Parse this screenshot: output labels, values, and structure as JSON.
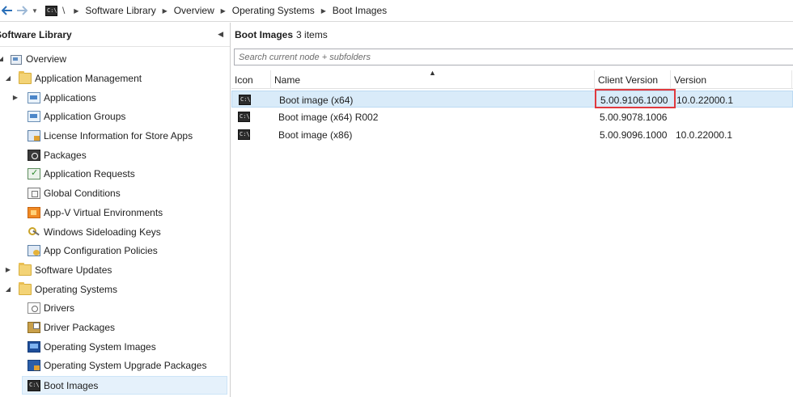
{
  "breadcrumb": {
    "root": "\\",
    "items": [
      "Software Library",
      "Overview",
      "Operating Systems",
      "Boot Images"
    ]
  },
  "left_pane": {
    "title": "Software Library",
    "tree": [
      {
        "label": "Overview",
        "icon": "overview-icon",
        "level": 0,
        "expander": "expanded"
      },
      {
        "label": "Application Management",
        "icon": "folder-icon",
        "level": 1,
        "expander": "expanded"
      },
      {
        "label": "Applications",
        "icon": "application-icon",
        "level": 2,
        "expander": "collapsed"
      },
      {
        "label": "Application Groups",
        "icon": "application-group-icon",
        "level": 2
      },
      {
        "label": "License Information for Store Apps",
        "icon": "license-icon",
        "level": 2
      },
      {
        "label": "Packages",
        "icon": "package-icon",
        "level": 2
      },
      {
        "label": "Application Requests",
        "icon": "application-request-icon",
        "level": 2
      },
      {
        "label": "Global Conditions",
        "icon": "global-condition-icon",
        "level": 2
      },
      {
        "label": "App-V Virtual Environments",
        "icon": "appv-icon",
        "level": 2
      },
      {
        "label": "Windows Sideloading Keys",
        "icon": "key-icon",
        "level": 2
      },
      {
        "label": "App Configuration Policies",
        "icon": "config-policy-icon",
        "level": 2
      },
      {
        "label": "Software Updates",
        "icon": "folder-icon",
        "level": 1,
        "expander": "collapsed"
      },
      {
        "label": "Operating Systems",
        "icon": "folder-icon",
        "level": 1,
        "expander": "expanded"
      },
      {
        "label": "Drivers",
        "icon": "driver-icon",
        "level": 2
      },
      {
        "label": "Driver Packages",
        "icon": "driver-package-icon",
        "level": 2
      },
      {
        "label": "Operating System Images",
        "icon": "os-image-icon",
        "level": 2
      },
      {
        "label": "Operating System Upgrade Packages",
        "icon": "os-upgrade-icon",
        "level": 2
      },
      {
        "label": "Boot Images",
        "icon": "boot-image-icon",
        "level": 2,
        "selected": true
      }
    ]
  },
  "right_pane": {
    "title": "Boot Images",
    "count": "3 items",
    "search_placeholder": "Search current node + subfolders",
    "columns": [
      "Icon",
      "Name",
      "Client Version",
      "Version"
    ],
    "rows": [
      {
        "name": "Boot image (x64)",
        "client_version": "5.00.9106.1000",
        "version": "10.0.22000.1",
        "selected": true
      },
      {
        "name": "Boot image (x64) R002",
        "client_version": "5.00.9078.1006",
        "version": ""
      },
      {
        "name": "Boot image (x86)",
        "client_version": "5.00.9096.1000",
        "version": "10.0.22000.1"
      }
    ]
  },
  "colors": {
    "highlight_box": "#e0393e",
    "selected_row": "#d9ebf9",
    "selected_tree": "#e5f1fb"
  }
}
